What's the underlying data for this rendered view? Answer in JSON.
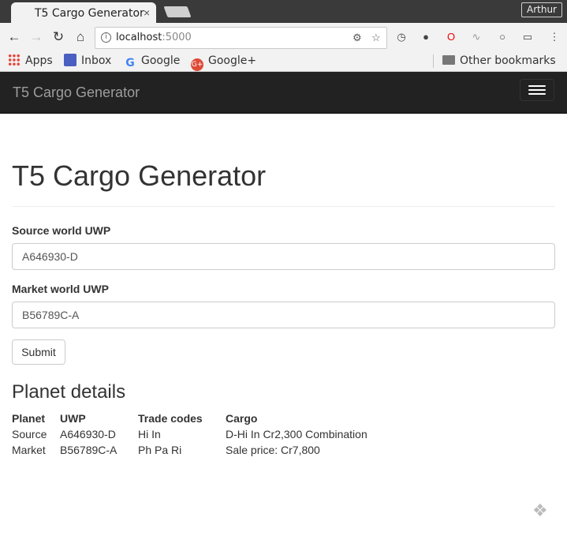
{
  "browser": {
    "tab_title": "T5 Cargo Generator",
    "tab_close": "×",
    "profile_name": "Arthur",
    "url_host": "localhost",
    "url_port": ":5000",
    "bookmarks": [
      {
        "label": "Apps",
        "icon": "apps-grid-icon"
      },
      {
        "label": "Inbox",
        "icon": "inbox-icon"
      },
      {
        "label": "Google",
        "icon": "google-icon"
      },
      {
        "label": "Google+",
        "icon": "google-plus-icon"
      }
    ],
    "other_bookmarks": "Other bookmarks"
  },
  "navbar": {
    "brand": "T5 Cargo Generator"
  },
  "main": {
    "heading": "T5 Cargo Generator",
    "source_label": "Source world UWP",
    "source_value": "A646930-D",
    "market_label": "Market world UWP",
    "market_value": "B56789C-A",
    "submit_label": "Submit",
    "details_heading": "Planet details",
    "table": {
      "headers": [
        "Planet",
        "UWP",
        "Trade codes",
        "Cargo"
      ],
      "rows": [
        [
          "Source",
          "A646930-D",
          "Hi In",
          "D-Hi In Cr2,300 Combination"
        ],
        [
          "Market",
          "B56789C-A",
          "Ph Pa Ri",
          "Sale price: Cr7,800"
        ]
      ]
    }
  },
  "colors": {
    "navbar_bg": "#222222",
    "brand_text": "#9d9d9d",
    "text": "#333333"
  }
}
